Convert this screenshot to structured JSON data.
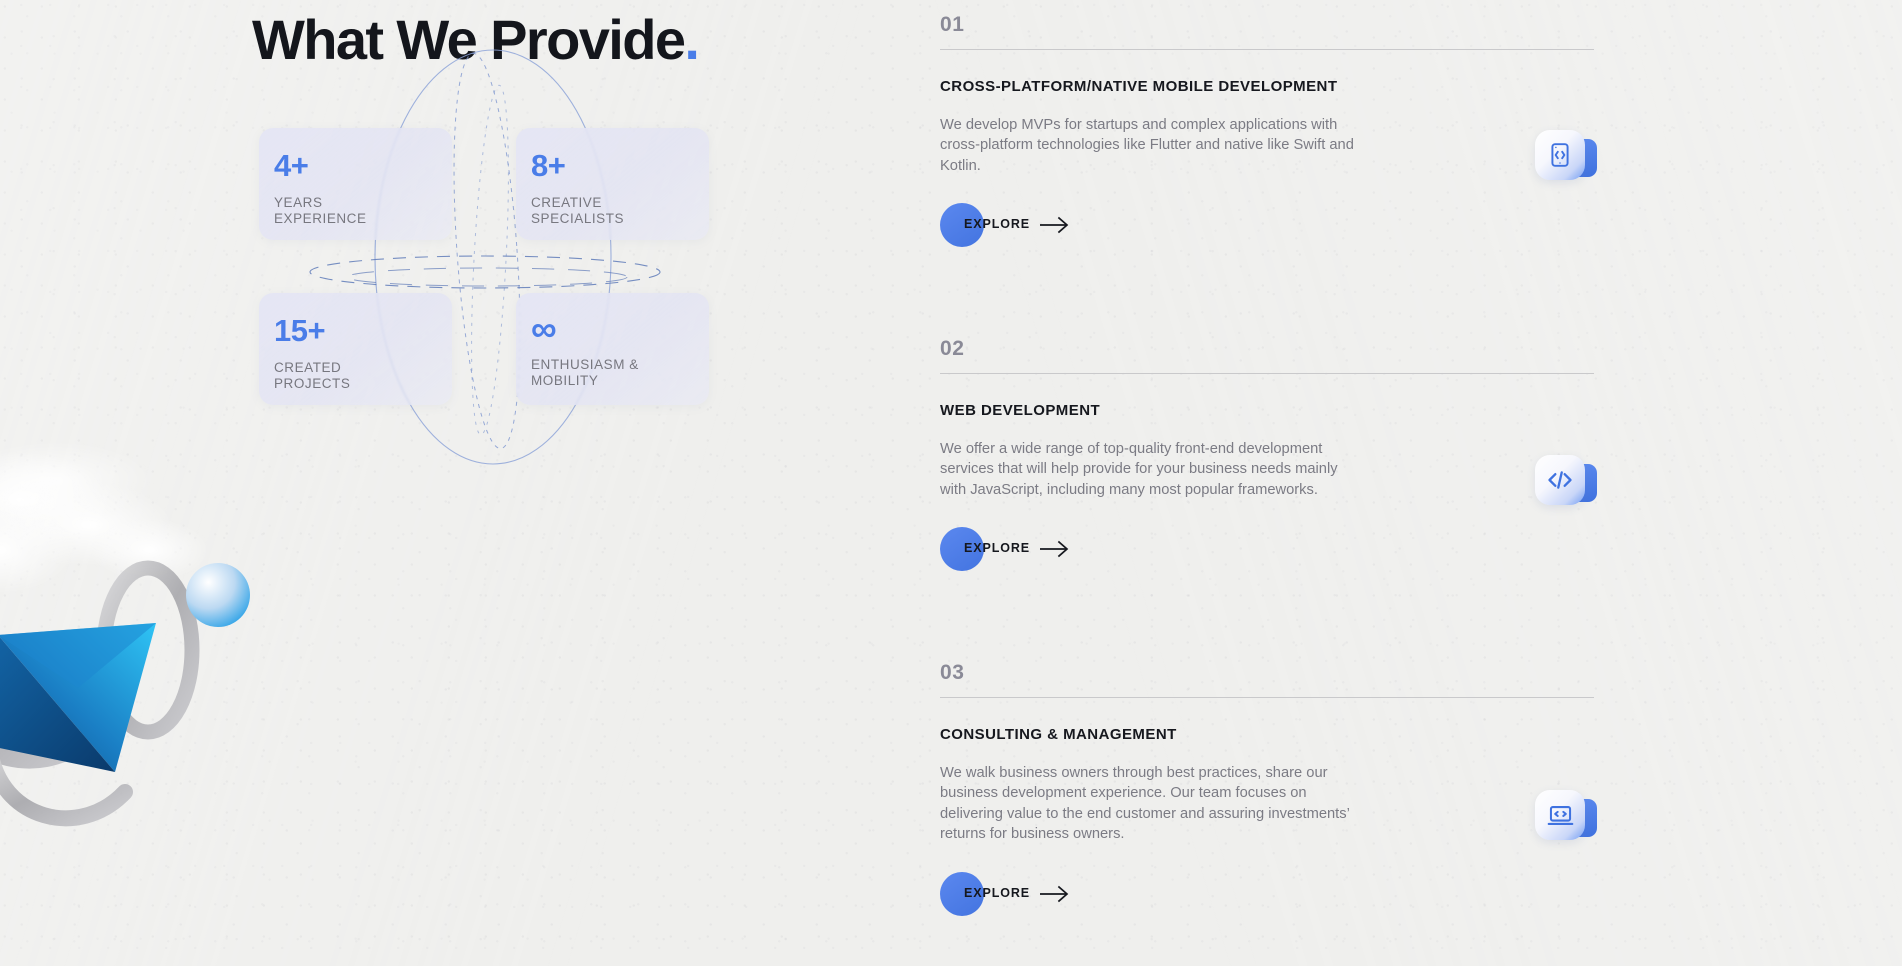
{
  "theme": {
    "background": "#efefed",
    "accent_blue": "#4a7de8",
    "card_bg": "#e4e5f4",
    "heading_color": "#14161c",
    "muted_text": "#7b7b84",
    "number_color": "#8a8a97",
    "rule_color": "#c9c9cb"
  },
  "header": {
    "title": "What We Provide",
    "title_dot": "."
  },
  "stats": [
    {
      "value": "4+",
      "label": "YEARS\nEXPERIENCE",
      "icon": "number-badge"
    },
    {
      "value": "8+",
      "label": "CREATIVE\nSPECIALISTS",
      "icon": "number-badge"
    },
    {
      "value": "15+",
      "label": "CREATED\nPROJECTS",
      "icon": "number-badge"
    },
    {
      "value": "∞",
      "label": "ENTHUSIASM &\nMOBILITY",
      "icon": "infinity-icon"
    }
  ],
  "services": [
    {
      "number": "01",
      "title": "CROSS-PLATFORM/NATIVE MOBILE DEVELOPMENT",
      "description": "We develop MVPs for startups and complex applications with cross-platform technologies like Flutter and native like Swift and Kotlin.",
      "cta": "EXPLORE",
      "icon": "mobile-code-icon"
    },
    {
      "number": "02",
      "title": "WEB DEVELOPMENT",
      "description": "We offer a wide range of top-quality front-end development services that will help provide for your business needs mainly with JavaScript, including many most popular frameworks.",
      "cta": "EXPLORE",
      "icon": "code-brackets-icon"
    },
    {
      "number": "03",
      "title": "CONSULTING & MANAGEMENT",
      "description": "We walk business owners through best practices, share our business development experience. Our team focuses on delivering value to the end customer and assuring investments’ returns for business owners.",
      "cta": "EXPLORE",
      "icon": "laptop-code-icon"
    }
  ],
  "decoration": {
    "orbit": "abstract-orbit-ellipses",
    "illustration": "3d-cone-torus-sphere-clouds"
  }
}
